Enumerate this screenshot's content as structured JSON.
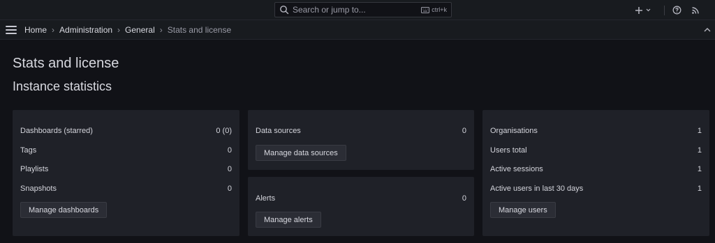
{
  "topbar": {
    "search_placeholder": "Search or jump to...",
    "shortcut": "ctrl+k",
    "icons": [
      "search-icon",
      "keyboard-icon",
      "plus-icon",
      "chevron-down-icon",
      "help-icon",
      "rss-icon"
    ]
  },
  "breadcrumb": [
    "Home",
    "Administration",
    "General",
    "Stats and license"
  ],
  "page_title": "Stats and license",
  "section_title": "Instance statistics",
  "cards": {
    "dashboards": {
      "rows": [
        {
          "label": "Dashboards (starred)",
          "value": "0 (0)"
        },
        {
          "label": "Tags",
          "value": "0"
        },
        {
          "label": "Playlists",
          "value": "0"
        },
        {
          "label": "Snapshots",
          "value": "0"
        }
      ],
      "button": "Manage dashboards"
    },
    "datasources": {
      "rows": [
        {
          "label": "Data sources",
          "value": "0"
        }
      ],
      "button": "Manage data sources"
    },
    "alerts": {
      "rows": [
        {
          "label": "Alerts",
          "value": "0"
        }
      ],
      "button": "Manage alerts"
    },
    "users": {
      "rows": [
        {
          "label": "Organisations",
          "value": "1"
        },
        {
          "label": "Users total",
          "value": "1"
        },
        {
          "label": "Active sessions",
          "value": "1"
        },
        {
          "label": "Active users in last 30 days",
          "value": "1"
        }
      ],
      "button": "Manage users"
    }
  },
  "colors": {
    "background": "#111217",
    "panel": "#1f2128",
    "topbar": "#181b1f",
    "text": "#d8d9e0",
    "button": "#2b2d35"
  }
}
